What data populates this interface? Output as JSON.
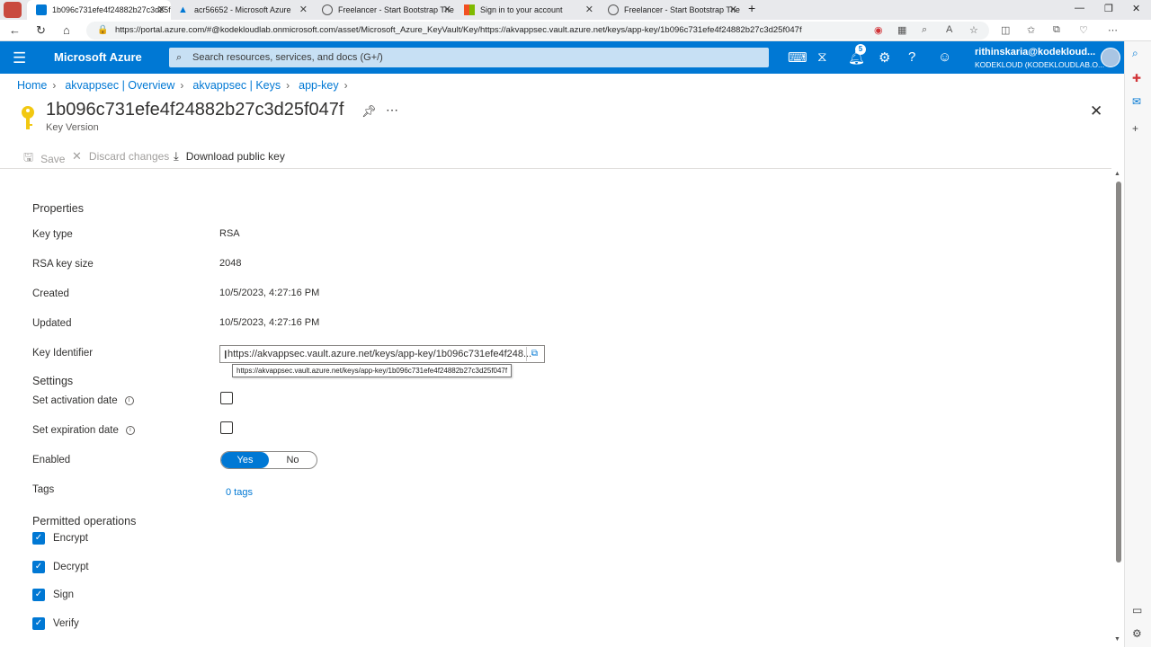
{
  "browser": {
    "tabs": [
      {
        "title": "1b096c731efe4f24882b27c3d25f",
        "active": true,
        "icon": "key-vault-favicon"
      },
      {
        "title": "acr56652 - Microsoft Azure",
        "active": false,
        "icon": "azure-favicon"
      },
      {
        "title": "Freelancer - Start Bootstrap The",
        "active": false,
        "icon": "globe-favicon"
      },
      {
        "title": "Sign in to your account",
        "active": false,
        "icon": "microsoft-favicon"
      },
      {
        "title": "Freelancer - Start Bootstrap The",
        "active": false,
        "icon": "globe-favicon"
      }
    ],
    "url": "https://portal.azure.com/#@kodekloudlab.onmicrosoft.com/asset/Microsoft_Azure_KeyVault/Key/https://akvappsec.vault.azure.net/keys/app-key/1b096c731efe4f24882b27c3d25f047f"
  },
  "portal": {
    "brand": "Microsoft Azure",
    "search_placeholder": "Search resources, services, and docs (G+/)",
    "notification_count": "5",
    "user_name": "rithinskaria@kodekloud...",
    "user_directory": "KODEKLOUD (KODEKLOUDLAB.O..."
  },
  "breadcrumb": [
    "Home",
    "akvappsec | Overview",
    "akvappsec | Keys",
    "app-key"
  ],
  "header": {
    "title": "1b096c731efe4f24882b27c3d25f047f",
    "subtitle": "Key Version"
  },
  "commands": {
    "save": "Save",
    "discard": "Discard changes",
    "download": "Download public key"
  },
  "properties": {
    "section_title": "Properties",
    "key_type_label": "Key type",
    "key_type": "RSA",
    "key_size_label": "RSA key size",
    "key_size": "2048",
    "created_label": "Created",
    "created": "10/5/2023, 4:27:16 PM",
    "updated_label": "Updated",
    "updated": "10/5/2023, 4:27:16 PM",
    "key_identifier_label": "Key Identifier",
    "key_identifier": "https://akvappsec.vault.azure.net/keys/app-key/1b096c731efe4f248...",
    "key_identifier_tooltip": "https://akvappsec.vault.azure.net/keys/app-key/1b096c731efe4f24882b27c3d25f047f"
  },
  "settings": {
    "section_title": "Settings",
    "activation_label": "Set activation date",
    "expiration_label": "Set expiration date",
    "enabled_label": "Enabled",
    "enabled_yes": "Yes",
    "enabled_no": "No",
    "enabled_value": "Yes",
    "tags_label": "Tags",
    "tags_value": "0 tags"
  },
  "operations": {
    "section_title": "Permitted operations",
    "items": [
      "Encrypt",
      "Decrypt",
      "Sign",
      "Verify"
    ]
  },
  "colors": {
    "accent": "#0078d4",
    "topbar": "#0078d4",
    "search_bg": "#c7e0f4"
  }
}
